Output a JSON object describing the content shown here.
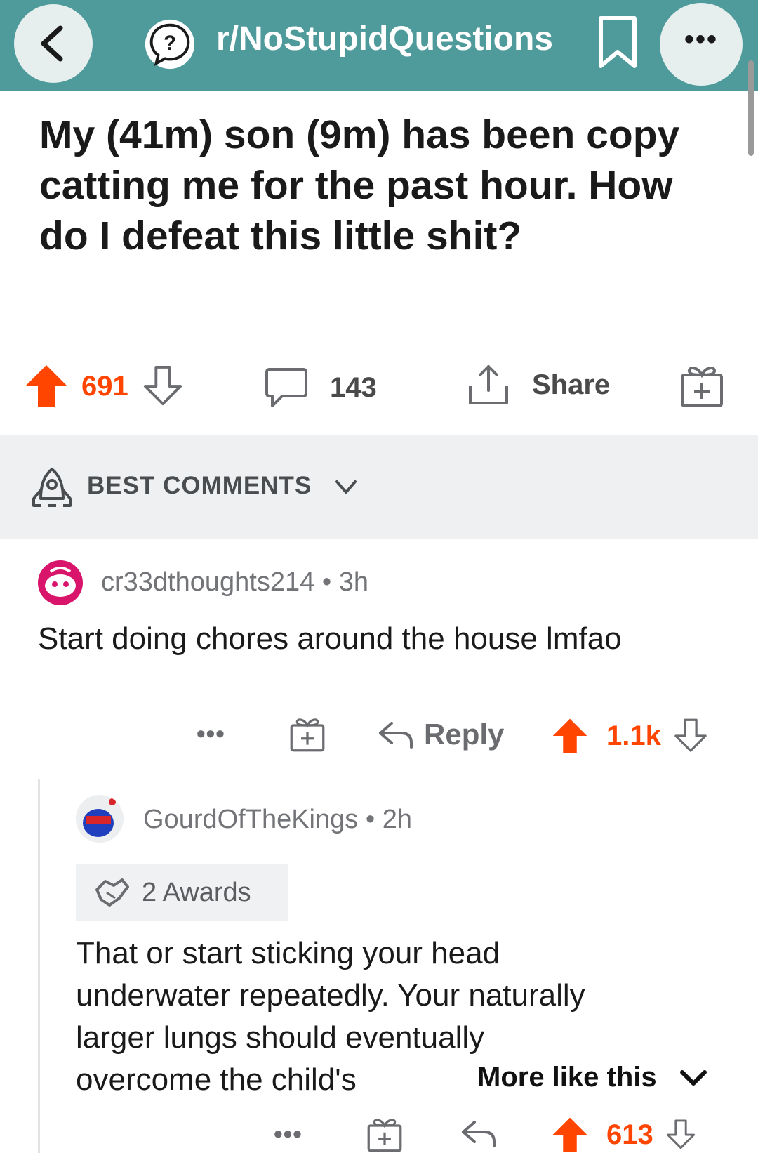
{
  "header": {
    "subreddit": "r/NoStupidQuestions",
    "back_icon": "chevron-left-icon",
    "subreddit_icon": "question-bubble-icon",
    "bookmark_icon": "bookmark-icon",
    "more_label": "•••",
    "bg_color": "#4f9a9a"
  },
  "post": {
    "title": "My (41m) son (9m) has been copy catting me for the past hour. How do I defeat this little shit?",
    "upvotes": "691",
    "comments": "143",
    "share_label": "Share"
  },
  "sort": {
    "label": "BEST COMMENTS"
  },
  "comments": [
    {
      "author": "cr33dthoughts214",
      "age": "3h",
      "separator": "•",
      "text": "Start doing chores around the house lmfao",
      "more": "•••",
      "reply_label": "Reply",
      "score": "1.1k"
    },
    {
      "author": "GourdOfTheKings",
      "age": "2h",
      "separator": "•",
      "awards": "2 Awards",
      "text_lines": [
        "That or start sticking your head",
        "underwater repeatedly. Your naturally",
        "larger lungs should eventually",
        "overcome the child's"
      ],
      "more": "•••",
      "score": "613"
    }
  ],
  "more_like_this": "More like this",
  "colors": {
    "upvote": "#ff4500",
    "text": "#1a1a1b",
    "muted": "#727478"
  }
}
